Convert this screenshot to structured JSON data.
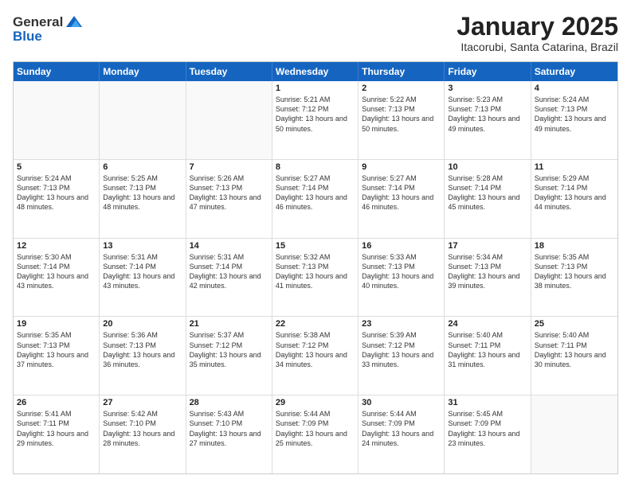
{
  "logo": {
    "general": "General",
    "blue": "Blue"
  },
  "title": "January 2025",
  "location": "Itacorubi, Santa Catarina, Brazil",
  "header_days": [
    "Sunday",
    "Monday",
    "Tuesday",
    "Wednesday",
    "Thursday",
    "Friday",
    "Saturday"
  ],
  "weeks": [
    [
      {
        "day": "",
        "sunrise": "",
        "sunset": "",
        "daylight": ""
      },
      {
        "day": "",
        "sunrise": "",
        "sunset": "",
        "daylight": ""
      },
      {
        "day": "",
        "sunrise": "",
        "sunset": "",
        "daylight": ""
      },
      {
        "day": "1",
        "sunrise": "Sunrise: 5:21 AM",
        "sunset": "Sunset: 7:12 PM",
        "daylight": "Daylight: 13 hours and 50 minutes."
      },
      {
        "day": "2",
        "sunrise": "Sunrise: 5:22 AM",
        "sunset": "Sunset: 7:13 PM",
        "daylight": "Daylight: 13 hours and 50 minutes."
      },
      {
        "day": "3",
        "sunrise": "Sunrise: 5:23 AM",
        "sunset": "Sunset: 7:13 PM",
        "daylight": "Daylight: 13 hours and 49 minutes."
      },
      {
        "day": "4",
        "sunrise": "Sunrise: 5:24 AM",
        "sunset": "Sunset: 7:13 PM",
        "daylight": "Daylight: 13 hours and 49 minutes."
      }
    ],
    [
      {
        "day": "5",
        "sunrise": "Sunrise: 5:24 AM",
        "sunset": "Sunset: 7:13 PM",
        "daylight": "Daylight: 13 hours and 48 minutes."
      },
      {
        "day": "6",
        "sunrise": "Sunrise: 5:25 AM",
        "sunset": "Sunset: 7:13 PM",
        "daylight": "Daylight: 13 hours and 48 minutes."
      },
      {
        "day": "7",
        "sunrise": "Sunrise: 5:26 AM",
        "sunset": "Sunset: 7:13 PM",
        "daylight": "Daylight: 13 hours and 47 minutes."
      },
      {
        "day": "8",
        "sunrise": "Sunrise: 5:27 AM",
        "sunset": "Sunset: 7:14 PM",
        "daylight": "Daylight: 13 hours and 46 minutes."
      },
      {
        "day": "9",
        "sunrise": "Sunrise: 5:27 AM",
        "sunset": "Sunset: 7:14 PM",
        "daylight": "Daylight: 13 hours and 46 minutes."
      },
      {
        "day": "10",
        "sunrise": "Sunrise: 5:28 AM",
        "sunset": "Sunset: 7:14 PM",
        "daylight": "Daylight: 13 hours and 45 minutes."
      },
      {
        "day": "11",
        "sunrise": "Sunrise: 5:29 AM",
        "sunset": "Sunset: 7:14 PM",
        "daylight": "Daylight: 13 hours and 44 minutes."
      }
    ],
    [
      {
        "day": "12",
        "sunrise": "Sunrise: 5:30 AM",
        "sunset": "Sunset: 7:14 PM",
        "daylight": "Daylight: 13 hours and 43 minutes."
      },
      {
        "day": "13",
        "sunrise": "Sunrise: 5:31 AM",
        "sunset": "Sunset: 7:14 PM",
        "daylight": "Daylight: 13 hours and 43 minutes."
      },
      {
        "day": "14",
        "sunrise": "Sunrise: 5:31 AM",
        "sunset": "Sunset: 7:14 PM",
        "daylight": "Daylight: 13 hours and 42 minutes."
      },
      {
        "day": "15",
        "sunrise": "Sunrise: 5:32 AM",
        "sunset": "Sunset: 7:13 PM",
        "daylight": "Daylight: 13 hours and 41 minutes."
      },
      {
        "day": "16",
        "sunrise": "Sunrise: 5:33 AM",
        "sunset": "Sunset: 7:13 PM",
        "daylight": "Daylight: 13 hours and 40 minutes."
      },
      {
        "day": "17",
        "sunrise": "Sunrise: 5:34 AM",
        "sunset": "Sunset: 7:13 PM",
        "daylight": "Daylight: 13 hours and 39 minutes."
      },
      {
        "day": "18",
        "sunrise": "Sunrise: 5:35 AM",
        "sunset": "Sunset: 7:13 PM",
        "daylight": "Daylight: 13 hours and 38 minutes."
      }
    ],
    [
      {
        "day": "19",
        "sunrise": "Sunrise: 5:35 AM",
        "sunset": "Sunset: 7:13 PM",
        "daylight": "Daylight: 13 hours and 37 minutes."
      },
      {
        "day": "20",
        "sunrise": "Sunrise: 5:36 AM",
        "sunset": "Sunset: 7:13 PM",
        "daylight": "Daylight: 13 hours and 36 minutes."
      },
      {
        "day": "21",
        "sunrise": "Sunrise: 5:37 AM",
        "sunset": "Sunset: 7:12 PM",
        "daylight": "Daylight: 13 hours and 35 minutes."
      },
      {
        "day": "22",
        "sunrise": "Sunrise: 5:38 AM",
        "sunset": "Sunset: 7:12 PM",
        "daylight": "Daylight: 13 hours and 34 minutes."
      },
      {
        "day": "23",
        "sunrise": "Sunrise: 5:39 AM",
        "sunset": "Sunset: 7:12 PM",
        "daylight": "Daylight: 13 hours and 33 minutes."
      },
      {
        "day": "24",
        "sunrise": "Sunrise: 5:40 AM",
        "sunset": "Sunset: 7:11 PM",
        "daylight": "Daylight: 13 hours and 31 minutes."
      },
      {
        "day": "25",
        "sunrise": "Sunrise: 5:40 AM",
        "sunset": "Sunset: 7:11 PM",
        "daylight": "Daylight: 13 hours and 30 minutes."
      }
    ],
    [
      {
        "day": "26",
        "sunrise": "Sunrise: 5:41 AM",
        "sunset": "Sunset: 7:11 PM",
        "daylight": "Daylight: 13 hours and 29 minutes."
      },
      {
        "day": "27",
        "sunrise": "Sunrise: 5:42 AM",
        "sunset": "Sunset: 7:10 PM",
        "daylight": "Daylight: 13 hours and 28 minutes."
      },
      {
        "day": "28",
        "sunrise": "Sunrise: 5:43 AM",
        "sunset": "Sunset: 7:10 PM",
        "daylight": "Daylight: 13 hours and 27 minutes."
      },
      {
        "day": "29",
        "sunrise": "Sunrise: 5:44 AM",
        "sunset": "Sunset: 7:09 PM",
        "daylight": "Daylight: 13 hours and 25 minutes."
      },
      {
        "day": "30",
        "sunrise": "Sunrise: 5:44 AM",
        "sunset": "Sunset: 7:09 PM",
        "daylight": "Daylight: 13 hours and 24 minutes."
      },
      {
        "day": "31",
        "sunrise": "Sunrise: 5:45 AM",
        "sunset": "Sunset: 7:09 PM",
        "daylight": "Daylight: 13 hours and 23 minutes."
      },
      {
        "day": "",
        "sunrise": "",
        "sunset": "",
        "daylight": ""
      }
    ]
  ]
}
